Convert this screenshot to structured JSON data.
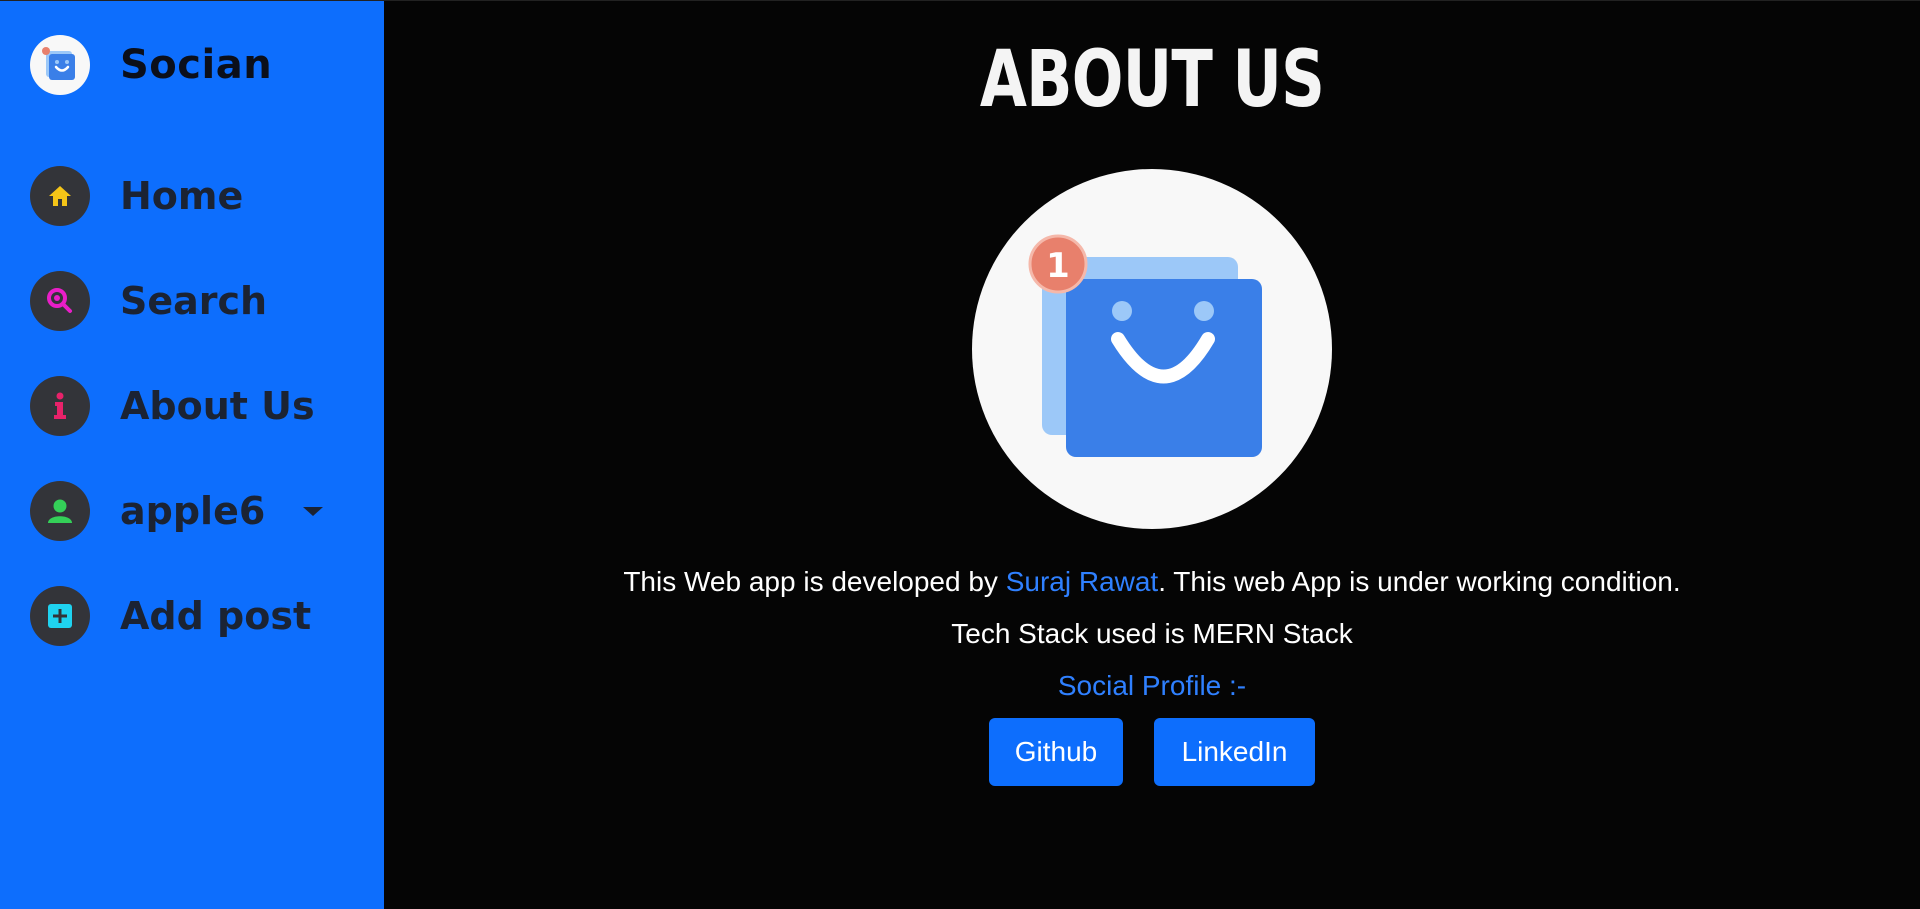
{
  "brand": {
    "name": "Socian",
    "logo_icon": "bag-smile-logo-icon"
  },
  "sidebar": {
    "items": [
      {
        "label": "Home",
        "icon": "home-icon",
        "color": "#f5c518"
      },
      {
        "label": "Search",
        "icon": "search-icon",
        "color": "#e91ec8"
      },
      {
        "label": "About Us",
        "icon": "info-icon",
        "color": "#e8226a"
      },
      {
        "label": "apple6",
        "icon": "user-icon",
        "color": "#34d058",
        "has_dropdown": true
      },
      {
        "label": "Add post",
        "icon": "add-square-icon",
        "color": "#1fd3f0"
      }
    ]
  },
  "main": {
    "title": "ABOUT US",
    "hero_icon": "bag-smile-logo-icon",
    "badge_count": "1",
    "description_prefix": "This Web app is developed by ",
    "author": "Suraj Rawat",
    "description_suffix": ". This web App is under working condition.",
    "tech_stack": "Tech Stack used is MERN Stack",
    "social_heading": "Social Profile :-",
    "buttons": {
      "github": "Github",
      "linkedin": "LinkedIn"
    }
  },
  "colors": {
    "sidebar_bg": "#0d6efd",
    "main_bg": "#050505",
    "link": "#2f80ff",
    "button_bg": "#0d6efd"
  }
}
